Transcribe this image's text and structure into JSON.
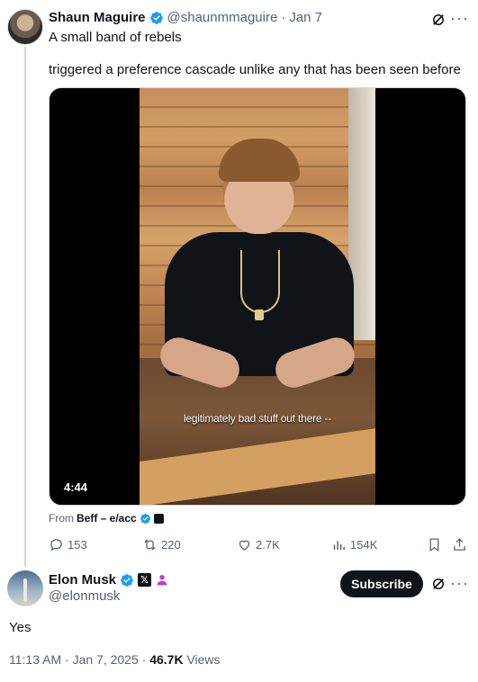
{
  "quoted_tweet": {
    "author_name": "Shaun Maguire",
    "handle": "@shaunmmaguire",
    "separator": "·",
    "date": "Jan 7",
    "line1": "A small band of rebels",
    "line2": "triggered a preference cascade unlike any that has been seen before",
    "media": {
      "caption": "legitimately bad stuff out there --",
      "duration": "4:44"
    },
    "from_label": "From",
    "from_source": "Beff – e/acc",
    "actions": {
      "replies": "153",
      "reposts": "220",
      "likes": "2.7K",
      "views": "154K"
    }
  },
  "main_tweet": {
    "author_name": "Elon Musk",
    "handle": "@elonmusk",
    "x_badge": "𝕏",
    "subscribe_label": "Subscribe",
    "text": "Yes",
    "meta": {
      "time": "11:13 AM",
      "separator": "·",
      "date": "Jan 7, 2025",
      "views_count": "46.7K",
      "views_label": "Views"
    }
  },
  "colors": {
    "text_primary": "#0f1419",
    "text_secondary": "#536471",
    "verified_blue": "#1d9bf0",
    "thread_line": "#cfd9de",
    "affiliate_purple": "#c035e0"
  },
  "icons": [
    "verified-badge-icon",
    "grok-icon",
    "more-icon",
    "reply-icon",
    "repost-icon",
    "like-icon",
    "views-icon",
    "bookmark-icon",
    "share-icon",
    "x-badge-icon",
    "affiliate-badge-icon"
  ]
}
